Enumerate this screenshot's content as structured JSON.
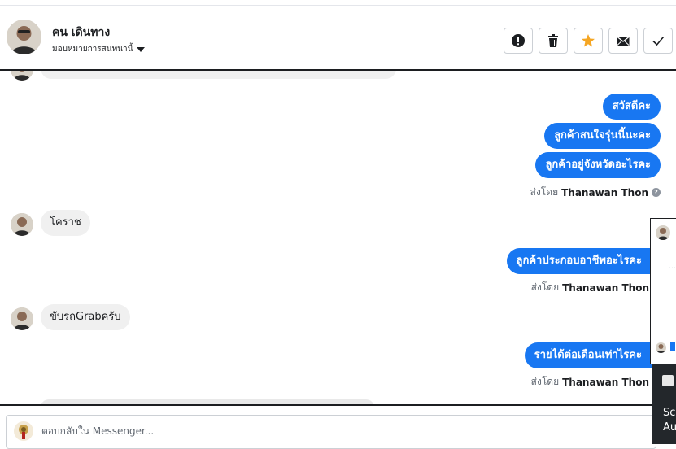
{
  "contact": {
    "name": "คน เดินทาง",
    "assign_label": "มอบหมายการสนทนานี้"
  },
  "toolbar": {
    "spam": "spam-icon",
    "delete": "trash-icon",
    "star": "star-icon",
    "unread": "envelope-icon",
    "done": "check-icon"
  },
  "colors": {
    "accent": "#1877f2",
    "star": "#f5a623",
    "incoming_bg": "#f0f0f0"
  },
  "messages": {
    "out1": "สวัสดีคะ",
    "out2": "ลูกค้าสนใจรุ่นนี้นะคะ",
    "out3": "ลูกค้าอยู่จังหวัดอะไรคะ",
    "in1": "โคราช",
    "out4": "ลูกค้าประกอบอาชีพอะไรคะ",
    "in2": "ขับรถGrabครับ",
    "out5": "รายได้ต่อเดือนเท่าไรคะ"
  },
  "sent_by": {
    "prefix": "ส่งโดย",
    "agent": "Thanawan Thon"
  },
  "composer": {
    "placeholder": "ตอบกลับใน Messenger..."
  },
  "overlay": {
    "line1": "Sc",
    "line2": "Au"
  }
}
